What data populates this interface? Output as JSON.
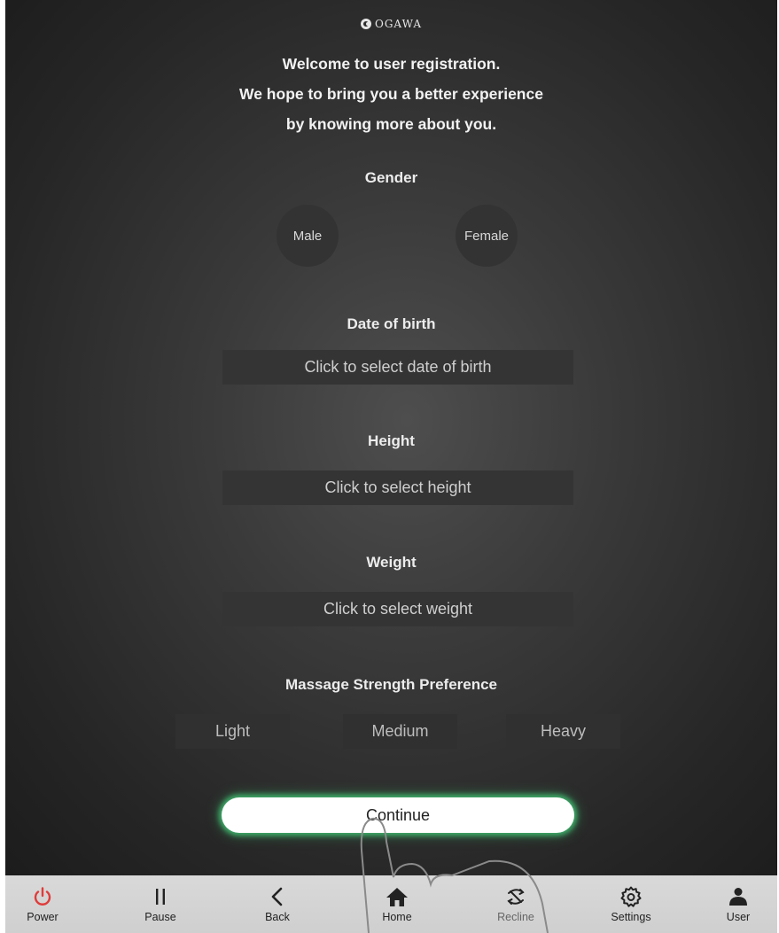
{
  "brand": {
    "logo_text": "OGAWA"
  },
  "welcome": {
    "line1": "Welcome to user registration.",
    "line2": "We hope to bring you a better experience",
    "line3": "by knowing more about you."
  },
  "gender": {
    "label": "Gender",
    "options": [
      "Male",
      "Female"
    ]
  },
  "dob": {
    "label": "Date of birth",
    "placeholder": "Click to select date of birth"
  },
  "height": {
    "label": "Height",
    "placeholder": "Click to select height"
  },
  "weight": {
    "label": "Weight",
    "placeholder": "Click to select weight"
  },
  "strength": {
    "label": "Massage Strength Preference",
    "options": [
      "Light",
      "Medium",
      "Heavy"
    ]
  },
  "continue_label": "Continue",
  "navbar": {
    "items": [
      {
        "label": "Power",
        "icon": "power-icon"
      },
      {
        "label": "Pause",
        "icon": "pause-icon"
      },
      {
        "label": "Back",
        "icon": "back-icon"
      },
      {
        "label": "Home",
        "icon": "home-icon"
      },
      {
        "label": "Recline",
        "icon": "recline-icon"
      },
      {
        "label": "Settings",
        "icon": "gear-icon"
      },
      {
        "label": "User",
        "icon": "user-icon"
      }
    ]
  },
  "colors": {
    "accent_glow": "#3fae6a",
    "power": "#e03b3b",
    "background": "#2b2b2b",
    "navbar": "#d4d4d4"
  }
}
